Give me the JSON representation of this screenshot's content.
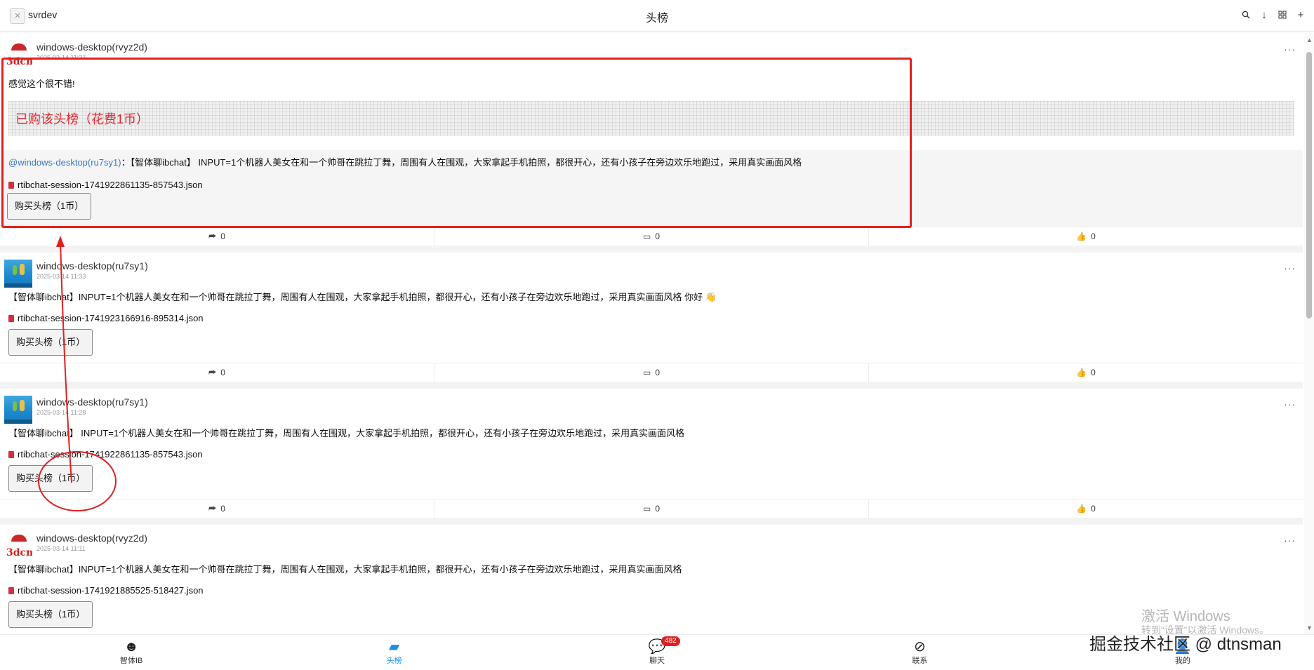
{
  "app": {
    "name": "svrdev",
    "title": "头榜"
  },
  "posts": [
    {
      "author": "windows-desktop(rvyz2d)",
      "time": "2025-03-14 11:37",
      "avatar": "3dcn",
      "content": "感觉这个很不错!",
      "purchased_label": "已购该头榜（花费1币）",
      "quote_mention": "@windows-desktop(ru7sy1)",
      "quote_sep": "：",
      "quote_text": "【智体聊ibchat】 INPUT=1个机器人美女在和一个帅哥在跳拉丁舞，周围有人在围观，大家拿起手机拍照，都很开心，还有小孩子在旁边欢乐地跑过，采用真实画面风格",
      "file": "rtibchat-session-1741922861135-857543.json",
      "buy_label": "购买头榜（1币）",
      "shares": "0",
      "comments": "0",
      "likes": "0"
    },
    {
      "author": "windows-desktop(ru7sy1)",
      "time": "2025-03-14 11:33",
      "avatar": "photo",
      "content": "【智体聊ibchat】INPUT=1个机器人美女在和一个帅哥在跳拉丁舞，周围有人在围观，大家拿起手机拍照，都很开心，还有小孩子在旁边欢乐地跑过，采用真实画面风格 你好 👋",
      "file": "rtibchat-session-1741923166916-895314.json",
      "buy_label": "购买头榜（1币）",
      "shares": "0",
      "comments": "0",
      "likes": "0"
    },
    {
      "author": "windows-desktop(ru7sy1)",
      "time": "2025-03-14 11:28",
      "avatar": "photo",
      "content": "【智体聊ibchat】 INPUT=1个机器人美女在和一个帅哥在跳拉丁舞，周围有人在围观，大家拿起手机拍照，都很开心，还有小孩子在旁边欢乐地跑过，采用真实画面风格",
      "file": "rtibchat-session-1741922861135-857543.json",
      "buy_label": "购买头榜（1币）",
      "shares": "0",
      "comments": "0",
      "likes": "0"
    },
    {
      "author": "windows-desktop(rvyz2d)",
      "time": "2025-03-14 11:11",
      "avatar": "3dcn",
      "content": "【智体聊ibchat】INPUT=1个机器人美女在和一个帅哥在跳拉丁舞，周围有人在围观，大家拿起手机拍照，都很开心，还有小孩子在旁边欢乐地跑过，采用真实画面风格",
      "file": "rtibchat-session-1741921885525-518427.json",
      "buy_label": "购买头榜（1币）"
    }
  ],
  "avatar_brand": "3dcn",
  "tabs": [
    {
      "label": "智体IB",
      "icon": "smile-icon"
    },
    {
      "label": "头榜",
      "icon": "chat-bubble-icon",
      "active": true
    },
    {
      "label": "聊天",
      "icon": "chat-icon",
      "badge": "482"
    },
    {
      "label": "联系",
      "icon": "compass-icon"
    },
    {
      "label": "我的",
      "icon": "user-icon"
    }
  ],
  "watermark": {
    "line1": "激活 Windows",
    "line2": "转到“设置”以激活 Windows。"
  },
  "credit": "掘金技术社区 @ dtnsman",
  "colors": {
    "accent": "#1a8ee8",
    "annotation": "#e02020",
    "mention": "#3a78c2",
    "badge": "#e02020"
  }
}
